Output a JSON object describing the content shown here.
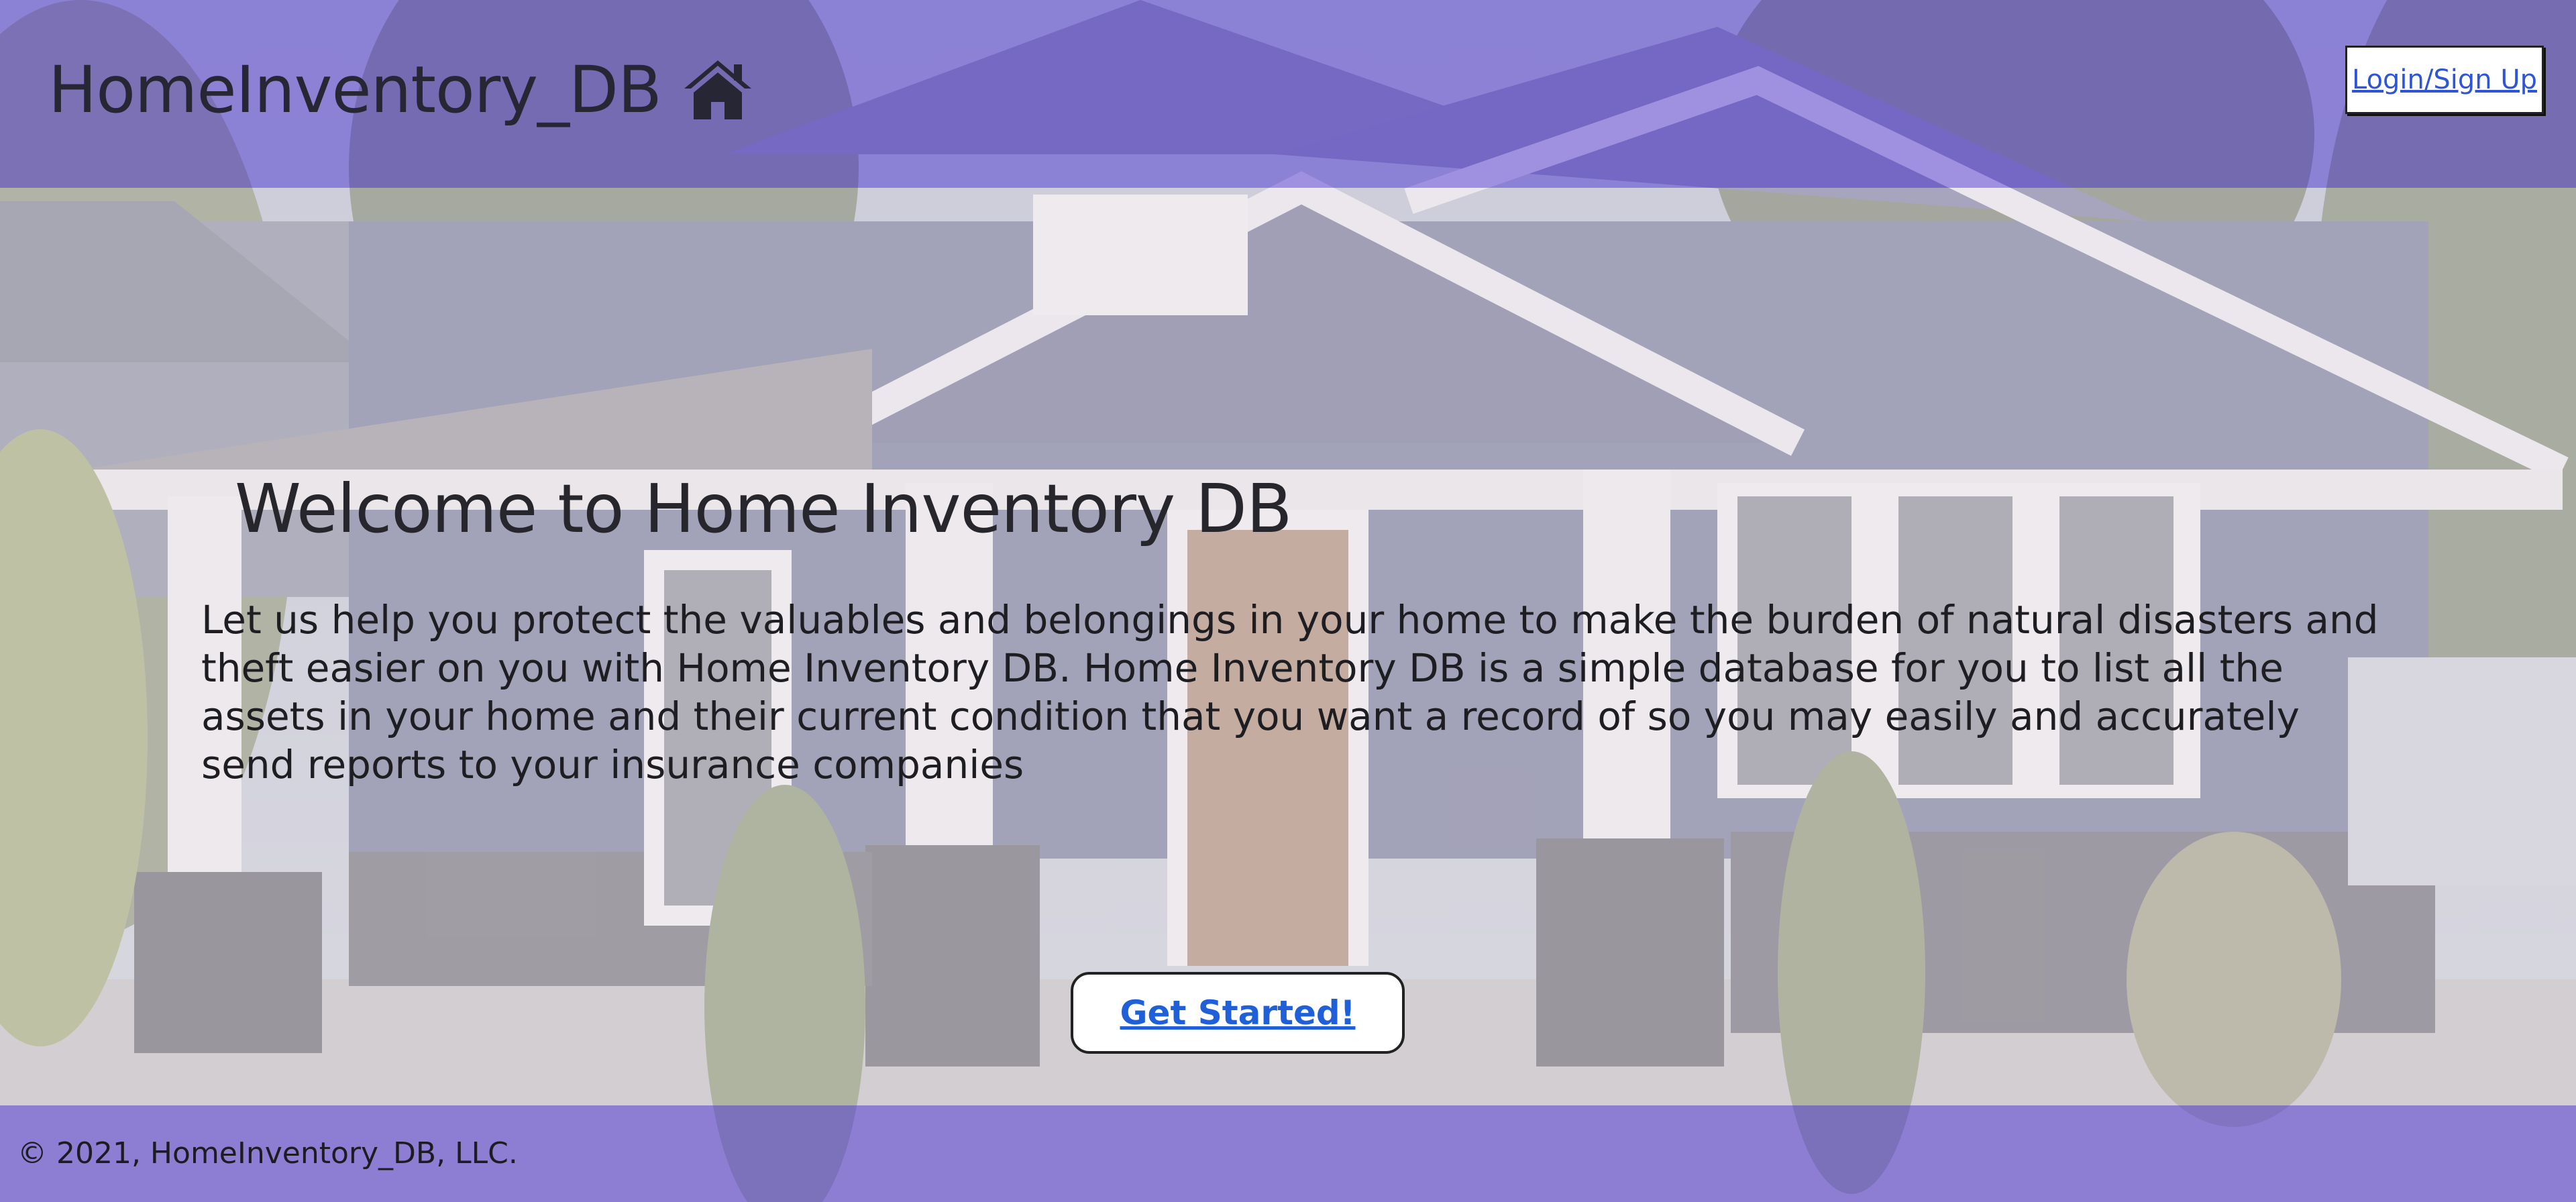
{
  "header": {
    "brand": "HomeInventory_DB",
    "brand_icon": "home-icon",
    "login_label": "Login/Sign Up"
  },
  "main": {
    "title": "Welcome to Home Inventory DB",
    "intro": "Let us help you protect the valuables and belongings in your home to make the burden of natural disasters and theft easier on you with Home Inventory DB. Home Inventory DB is a simple database for you to list all the assets in your home and their current condition that you want a record of so you may easily and accurately send reports to your insurance companies",
    "cta_label": "Get Started!"
  },
  "footer": {
    "copyright": "© 2021, HomeInventory_DB, LLC."
  },
  "colors": {
    "header_bg": "#806edc",
    "footer_bg": "#806edc",
    "link": "#2e55d6",
    "text": "#26262c"
  }
}
